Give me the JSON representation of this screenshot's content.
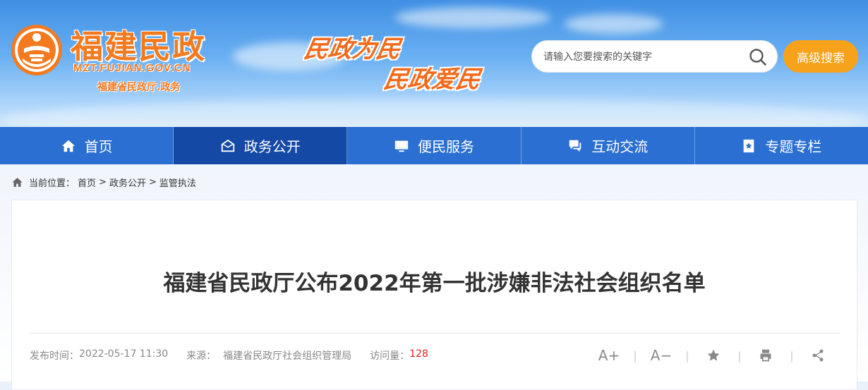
{
  "header": {
    "site_title": "福建民政",
    "domain": "MZT.FUJIAN.GOV.CN",
    "subtitle": "福建省民政厅.政务",
    "slogan_1": "民政为民",
    "slogan_2": "民政爱民"
  },
  "search": {
    "placeholder": "请输入您要搜索的关键字",
    "advanced_label": "高级搜索"
  },
  "nav": {
    "items": [
      {
        "label": "首页",
        "icon": "home-icon"
      },
      {
        "label": "政务公开",
        "icon": "envelope-icon",
        "active": true
      },
      {
        "label": "便民服务",
        "icon": "monitor-icon"
      },
      {
        "label": "互动交流",
        "icon": "chat-icon"
      },
      {
        "label": "专题专栏",
        "icon": "bookmark-star-icon"
      }
    ]
  },
  "breadcrumb": {
    "prefix": "当前位置：",
    "items": [
      "首页",
      "政务公开",
      "监管执法"
    ],
    "separator": ">"
  },
  "article": {
    "title": "福建省民政厅公布2022年第一批涉嫌非法社会组织名单",
    "publish_label": "发布时间：",
    "publish_time": "2022-05-17 11:30",
    "source_label": "来源：",
    "source": "福建省民政厅社会组织管理局",
    "visits_label": "访问量：",
    "visits": "128"
  },
  "tools": {
    "font_larger": "A+",
    "font_smaller": "A−",
    "separator": "|"
  },
  "colors": {
    "nav_bg": "#2a6fd1",
    "nav_active": "#1549a6",
    "accent_orange": "#f7a21b",
    "logo_orange": "#f47a1f",
    "visits_red": "#e02020"
  }
}
